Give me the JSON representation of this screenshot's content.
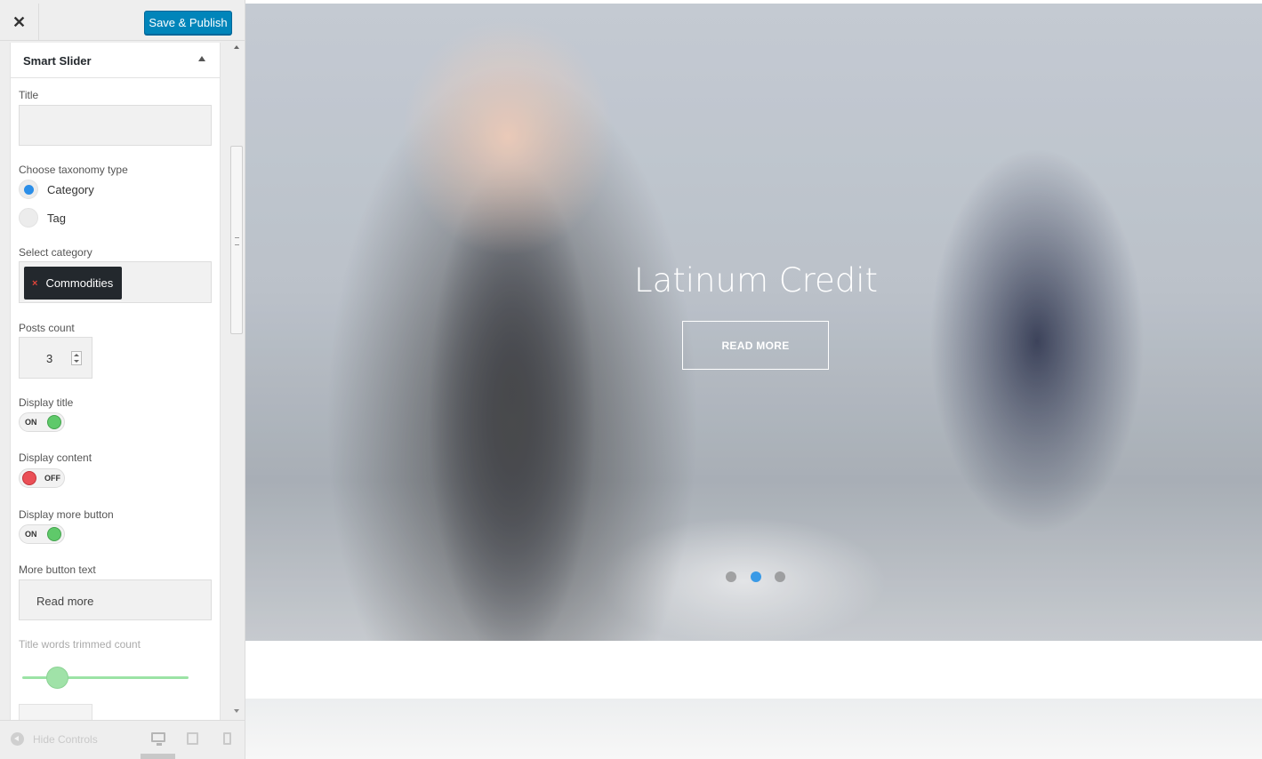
{
  "topbar": {
    "close_glyph": "✕",
    "publish_label": "Save & Publish"
  },
  "panel": {
    "title": "Smart Slider",
    "title_label": "Title",
    "title_value": "",
    "taxonomy_label": "Choose taxonomy type",
    "taxonomy_options": [
      "Category",
      "Tag"
    ],
    "taxonomy_selected": "Category",
    "category_label": "Select category",
    "selected_category": "Commodities",
    "remove_glyph": "×",
    "posts_count_label": "Posts count",
    "posts_count_value": "3",
    "display_title_label": "Display title",
    "display_title_state": "ON",
    "display_content_label": "Display content",
    "display_content_state": "OFF",
    "display_more_label": "Display more button",
    "display_more_state": "ON",
    "more_text_label": "More button text",
    "more_text_value": "Read more",
    "trim_label": "Title words trimmed count"
  },
  "footer": {
    "hide_controls_label": "Hide Controls",
    "devices": [
      "desktop-icon",
      "tablet-icon",
      "mobile-icon"
    ],
    "active_device": "desktop"
  },
  "preview": {
    "slide_title": "Latinum Credit",
    "slide_button": "READ MORE",
    "slide_dots": 3,
    "active_dot": 2
  },
  "colors": {
    "accent": "#0085ba",
    "toggle_on": "#5fc96a",
    "toggle_off": "#ea4f56",
    "active_dot": "#3a9ae6"
  }
}
